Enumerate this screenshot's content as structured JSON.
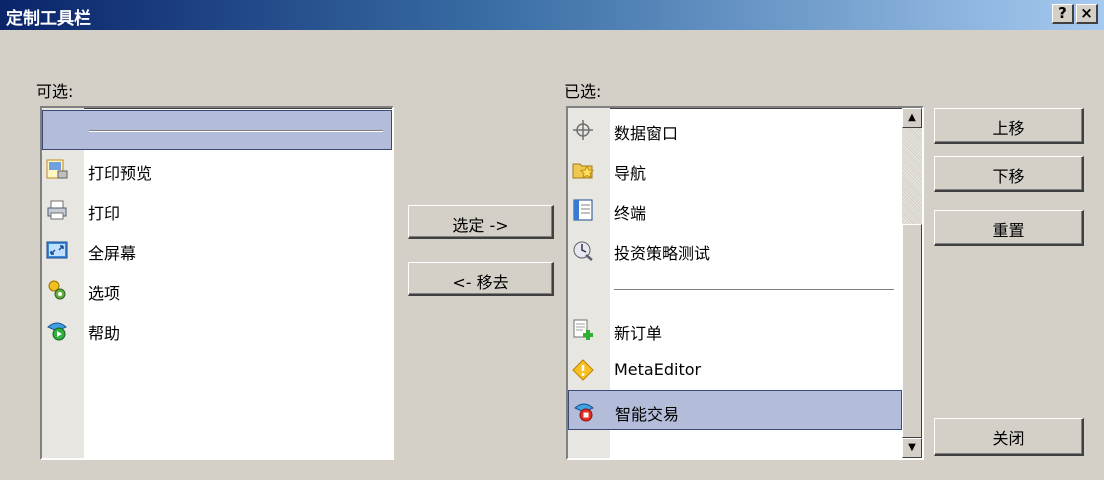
{
  "window": {
    "title": "定制工具栏",
    "help_label": "?",
    "close_label": "×"
  },
  "available": {
    "label": "可选:",
    "items": [
      {
        "type": "separator",
        "selected": true
      },
      {
        "type": "item",
        "label": "打印预览",
        "icon": "print-preview-icon"
      },
      {
        "type": "item",
        "label": "打印",
        "icon": "printer-icon"
      },
      {
        "type": "item",
        "label": "全屏幕",
        "icon": "fullscreen-icon"
      },
      {
        "type": "item",
        "label": "选项",
        "icon": "options-icon"
      },
      {
        "type": "item",
        "label": "帮助",
        "icon": "help-icon"
      }
    ]
  },
  "selected": {
    "label": "已选:",
    "items": [
      {
        "type": "item",
        "label": "数据窗口",
        "icon": "crosshair-icon"
      },
      {
        "type": "item",
        "label": "导航",
        "icon": "navigator-icon"
      },
      {
        "type": "item",
        "label": "终端",
        "icon": "terminal-icon"
      },
      {
        "type": "item",
        "label": "投资策略测试",
        "icon": "strategy-tester-icon"
      },
      {
        "type": "separator"
      },
      {
        "type": "item",
        "label": "新订单",
        "icon": "new-order-icon"
      },
      {
        "type": "item",
        "label": "MetaEditor",
        "icon": "metaeditor-icon"
      },
      {
        "type": "item",
        "label": "智能交易",
        "icon": "expert-advisors-icon",
        "selected": true
      }
    ]
  },
  "buttons": {
    "add": "选定 ->",
    "remove": "<- 移去",
    "move_up": "上移",
    "move_down": "下移",
    "reset": "重置",
    "close": "关闭"
  },
  "colors": {
    "selection": "#b3bdd9",
    "title_start": "#0a246a",
    "title_end": "#a6caf0"
  }
}
